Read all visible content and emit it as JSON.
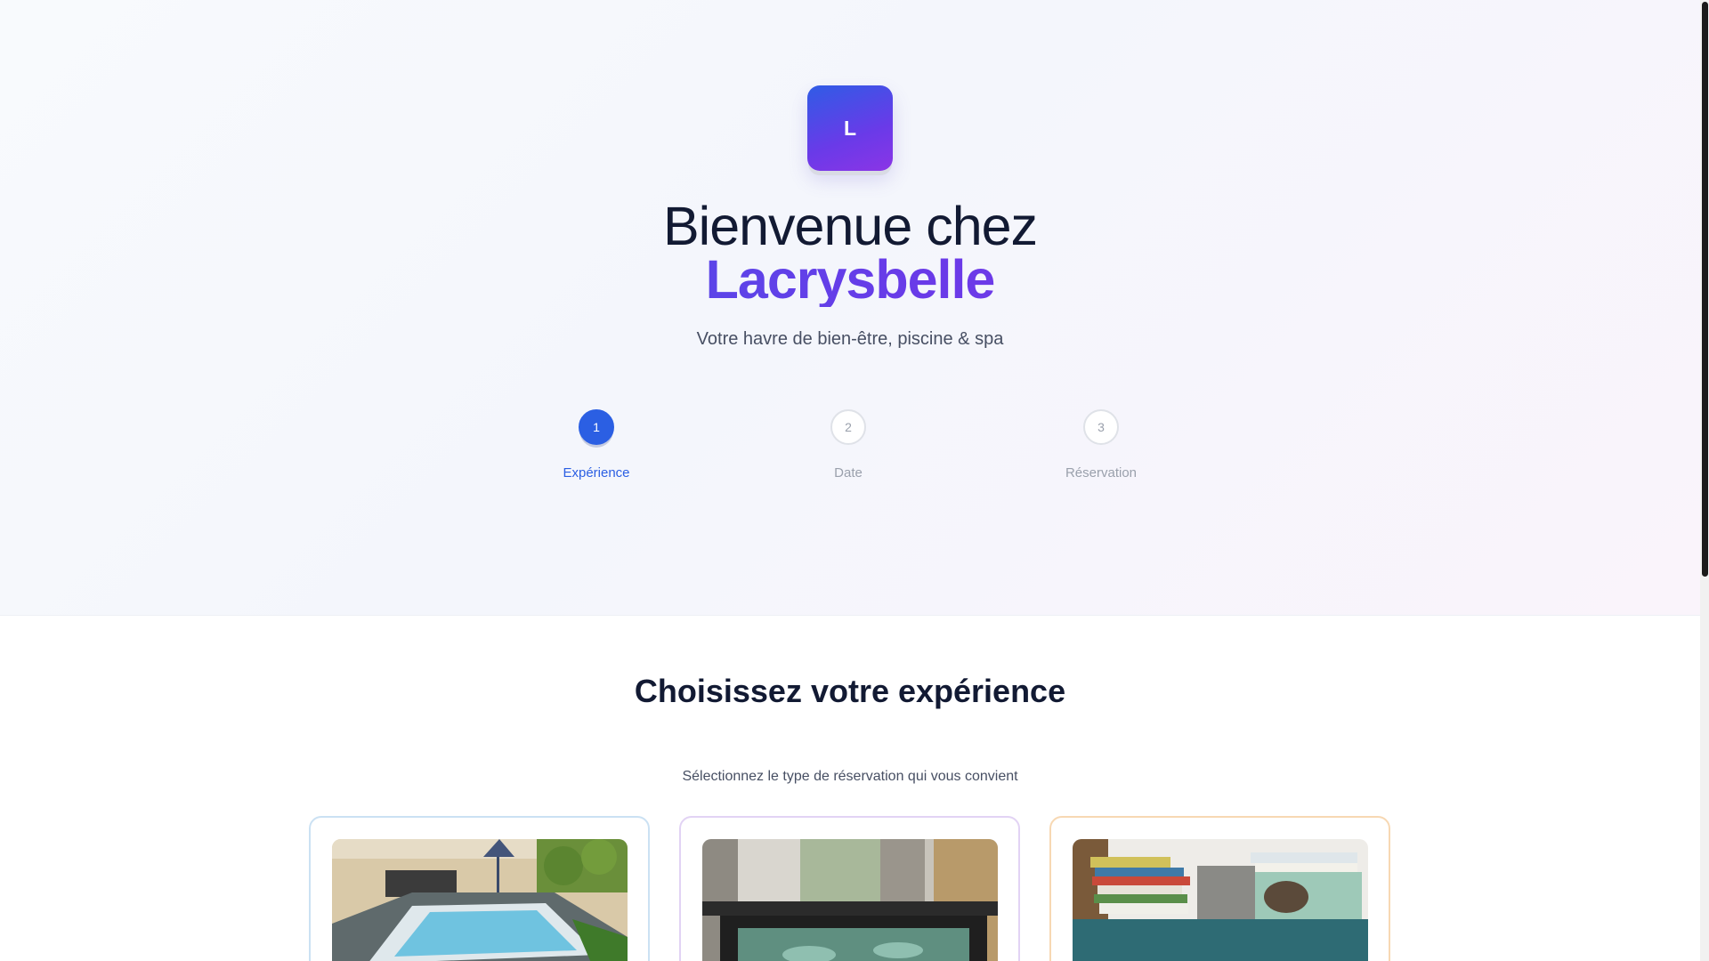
{
  "brand": {
    "logo_letter": "L"
  },
  "hero": {
    "title_line1": "Bienvenue chez",
    "title_line2": "Lacrysbelle",
    "subtitle": "Votre havre de bien-être, piscine & spa"
  },
  "steps": [
    {
      "number": "1",
      "label": "Expérience",
      "active": true
    },
    {
      "number": "2",
      "label": "Date",
      "active": false
    },
    {
      "number": "3",
      "label": "Réservation",
      "active": false
    }
  ],
  "section": {
    "title": "Choisissez votre expérience",
    "subtitle": "Sélectionnez le type de réservation qui vous convient"
  },
  "cards": [
    {
      "image": "pool-photo",
      "accent": "#cbe1f3"
    },
    {
      "image": "spa-jacuzzi-photo",
      "accent": "#e2d3f4"
    },
    {
      "image": "books-shelf-photo",
      "accent": "#f7d8b3"
    }
  ],
  "colors": {
    "primary": "#2b5fe3",
    "gradient_start": "#2f63e8",
    "gradient_end": "#8a39e6",
    "text_dark": "#121a33",
    "text_muted": "#474f63"
  }
}
